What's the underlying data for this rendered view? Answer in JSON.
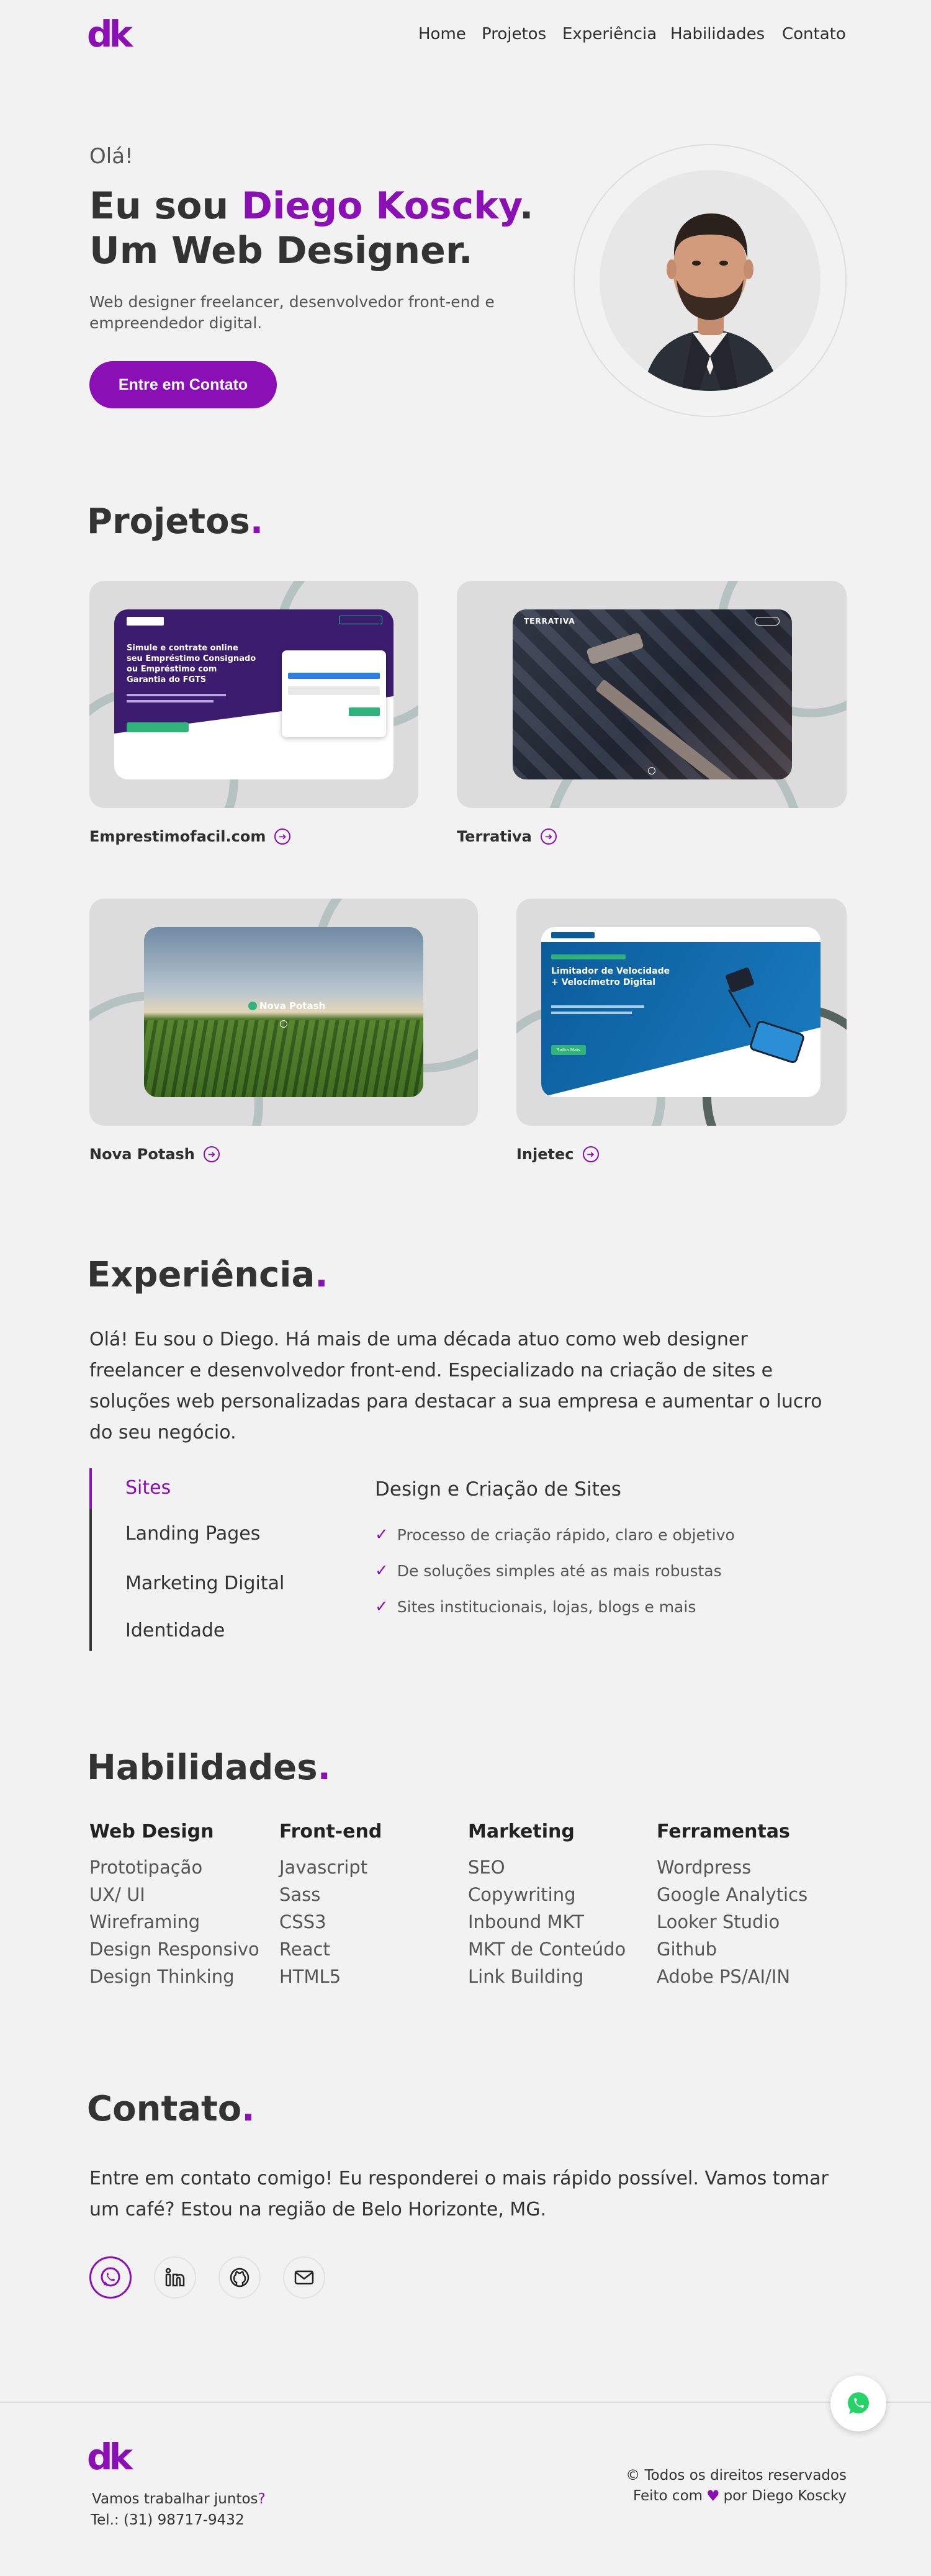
{
  "brand": {
    "logo": "dk",
    "accent": "#8a0fb5"
  },
  "nav": [
    "Home",
    "Projetos",
    "Experiência",
    "Habilidades",
    "Contato"
  ],
  "hero": {
    "greeting": "Olá!",
    "title_prefix": "Eu sou ",
    "name": "Diego Koscky",
    "title_dot": ".",
    "title_line2": "Um Web Designer.",
    "subtitle": "Web designer freelancer, desenvolvedor front-end e empreendedor digital.",
    "cta": "Entre em Contato"
  },
  "projects": {
    "title": "Projetos",
    "items": [
      {
        "name": "Emprestimofacil.com",
        "headline": "Simule e contrate online seu Empréstimo Consignado ou Empréstimo com Garantia do FGTS"
      },
      {
        "name": "Terrativa",
        "brand": "TERRATIVA"
      },
      {
        "name": "Nova Potash",
        "brand": "Nova Potash"
      },
      {
        "name": "Injetec",
        "headline": "Limitador de Velocidade + Velocímetro Digital",
        "button": "Saiba Mais"
      }
    ]
  },
  "experience": {
    "title": "Experiência",
    "text": "Olá! Eu sou o Diego. Há mais de uma década atuo como web designer freelancer e desenvolvedor front-end. Especializado na criação de sites e soluções web personalizadas para destacar a sua empresa e aumentar o lucro do seu negócio.",
    "tabs": [
      "Sites",
      "Landing Pages",
      "Marketing Digital",
      "Identidade"
    ],
    "active_heading": "Design e Criação de Sites",
    "active_items": [
      "Processo de criação rápido, claro e objetivo",
      "De soluções simples até as mais robustas",
      "Sites institucionais, lojas, blogs e mais"
    ]
  },
  "skills": {
    "title": "Habilidades",
    "columns": [
      {
        "heading": "Web Design",
        "items": [
          "Prototipação",
          "UX/ UI",
          "Wireframing",
          "Design Responsivo",
          "Design Thinking"
        ]
      },
      {
        "heading": "Front-end",
        "items": [
          "Javascript",
          "Sass",
          "CSS3",
          "React",
          "HTML5"
        ]
      },
      {
        "heading": "Marketing",
        "items": [
          "SEO",
          "Copywriting",
          "Inbound MKT",
          "MKT de Conteúdo",
          "Link Building"
        ]
      },
      {
        "heading": "Ferramentas",
        "items": [
          "Wordpress",
          "Google Analytics",
          "Looker Studio",
          "Github",
          "Adobe PS/AI/IN"
        ]
      }
    ]
  },
  "contact": {
    "title": "Contato",
    "text": "Entre em contato comigo! Eu responderei o mais rápido possível. Vamos tomar um café? Estou na região de Belo Horizonte, MG.",
    "socials": [
      "whatsapp-icon",
      "linkedin-icon",
      "github-icon",
      "mail-icon"
    ]
  },
  "footer": {
    "tagline_prefix": "Vamos trabalhar juntos",
    "tagline_mark": "?",
    "phone": "Tel.: (31) 98717-9432",
    "rights": "© Todos os direitos reservados",
    "made_prefix": "Feito com",
    "made_suffix": "por Diego Koscky"
  }
}
